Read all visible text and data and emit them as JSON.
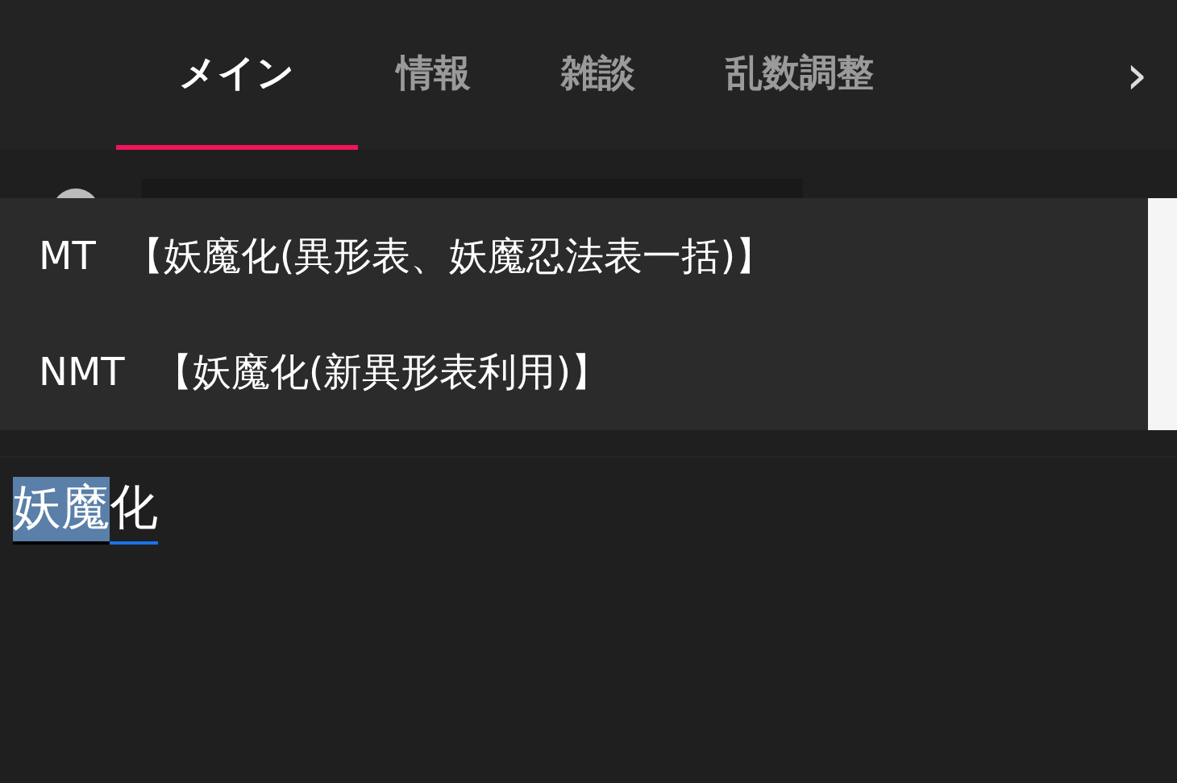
{
  "tabs": [
    {
      "label": "メイン",
      "selected": true
    },
    {
      "label": "情報",
      "selected": false
    },
    {
      "label": "雑談",
      "selected": false
    },
    {
      "label": "乱数調整",
      "selected": false
    }
  ],
  "tabs_more": "›",
  "suggestions": [
    {
      "prefix": "MT",
      "text": "【妖魔化(異形表、妖魔忍法表一括)】"
    },
    {
      "prefix": "NMT",
      "text": "【妖魔化(新異形表利用)】"
    }
  ],
  "composition": [
    {
      "text": "妖魔",
      "selected": true
    },
    {
      "text": "化",
      "selected": false
    }
  ]
}
